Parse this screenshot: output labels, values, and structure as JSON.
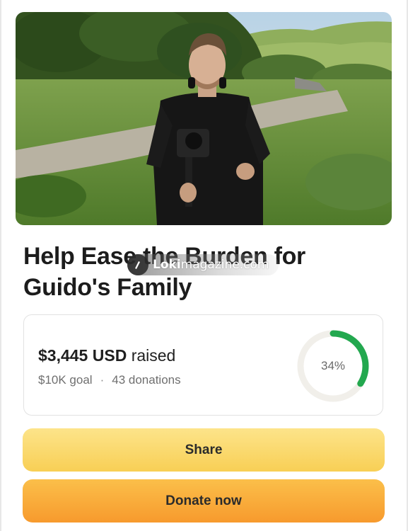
{
  "campaign": {
    "title": "Help Ease the Burden for Guido's Family",
    "hero_image": "campaign-photo-man-with-camera-gimbal-in-green-valley"
  },
  "watermark": {
    "brand_bold": "Loki",
    "brand_rest": "magazine.com",
    "icon": "pen-nib-icon"
  },
  "progress": {
    "amount": "$3,445 USD",
    "raised_suffix": "raised",
    "goal": "$10K goal",
    "separator": "·",
    "donations": "43 donations",
    "percent_label": "34%",
    "fraction": 0.34
  },
  "actions": {
    "share_label": "Share",
    "donate_label": "Donate now"
  },
  "colors": {
    "ring_progress": "#23a84f",
    "ring_track": "#f1efea",
    "share_button": "#fbd96c",
    "donate_button": "#f9ac3b",
    "title_text": "#1c1c1c"
  }
}
